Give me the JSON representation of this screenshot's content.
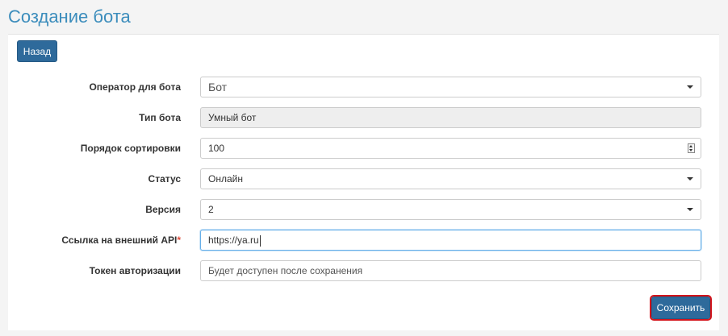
{
  "page": {
    "title": "Создание бота"
  },
  "toolbar": {
    "back_label": "Назад"
  },
  "form": {
    "operator": {
      "label": "Оператор для бота",
      "value": "Бот"
    },
    "bot_type": {
      "label": "Тип бота",
      "value": "Умный бот"
    },
    "sort_order": {
      "label": "Порядок сортировки",
      "value": "100"
    },
    "status": {
      "label": "Статус",
      "value": "Онлайн"
    },
    "version": {
      "label": "Версия",
      "value": "2"
    },
    "api_url": {
      "label": "Ссылка на внешний API",
      "required_mark": "*",
      "value": "https://ya.ru"
    },
    "auth_token": {
      "label": "Токен авторизации",
      "value": "Будет доступен после сохранения"
    }
  },
  "actions": {
    "save_label": "Сохранить"
  },
  "colors": {
    "title": "#3c8dbc",
    "primary_button": "#2e6a9b",
    "required": "#dd4b39",
    "highlight_outline": "#d3141b",
    "focus_border": "#66afe9"
  },
  "icons": {
    "dropdown": "caret-down-icon",
    "number_spinner": "spinner-icon"
  }
}
